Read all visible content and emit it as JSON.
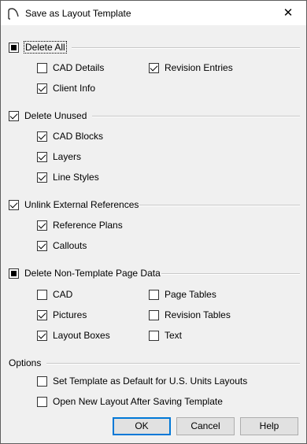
{
  "window": {
    "title": "Save as Layout Template",
    "close_glyph": "✕"
  },
  "groups": {
    "delete_all": {
      "label": "Delete All",
      "state": "mixed",
      "items": {
        "cad_details": {
          "label": "CAD Details",
          "checked": false
        },
        "revision_entries": {
          "label": "Revision Entries",
          "checked": true
        },
        "client_info": {
          "label": "Client Info",
          "checked": true
        }
      }
    },
    "delete_unused": {
      "label": "Delete Unused",
      "state": "checked",
      "items": {
        "cad_blocks": {
          "label": "CAD Blocks",
          "checked": true
        },
        "layers": {
          "label": "Layers",
          "checked": true
        },
        "line_styles": {
          "label": "Line Styles",
          "checked": true
        }
      }
    },
    "unlink_external": {
      "label": "Unlink External References",
      "state": "checked",
      "items": {
        "reference_plans": {
          "label": "Reference Plans",
          "checked": true
        },
        "callouts": {
          "label": "Callouts",
          "checked": true
        }
      }
    },
    "delete_non_template": {
      "label": "Delete Non-Template Page Data",
      "state": "mixed",
      "items": {
        "cad": {
          "label": "CAD",
          "checked": false
        },
        "page_tables": {
          "label": "Page Tables",
          "checked": false
        },
        "pictures": {
          "label": "Pictures",
          "checked": true
        },
        "revision_tables": {
          "label": "Revision Tables",
          "checked": false
        },
        "layout_boxes": {
          "label": "Layout Boxes",
          "checked": true
        },
        "text": {
          "label": "Text",
          "checked": false
        }
      }
    }
  },
  "options": {
    "label": "Options",
    "set_default": {
      "label": "Set Template as Default for U.S. Units Layouts",
      "checked": false
    },
    "open_new": {
      "label": "Open New Layout After Saving Template",
      "checked": false
    }
  },
  "buttons": {
    "ok": "OK",
    "cancel": "Cancel",
    "help": "Help"
  }
}
